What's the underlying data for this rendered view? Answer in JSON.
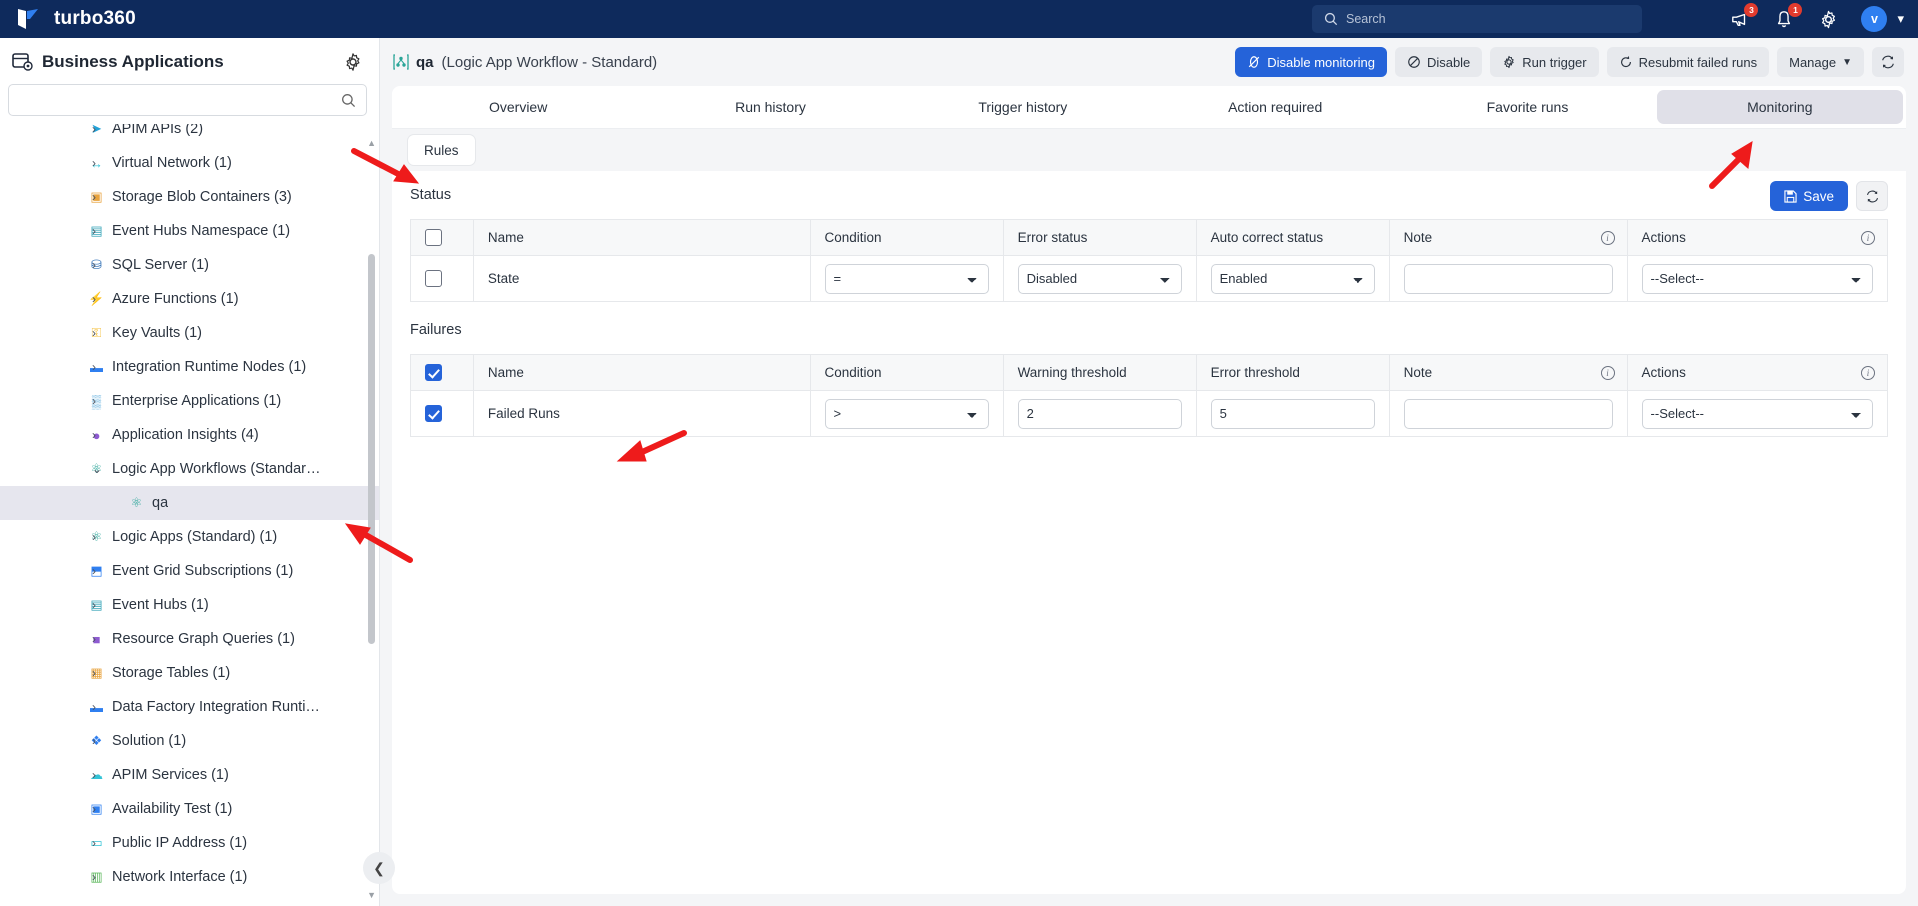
{
  "topbar": {
    "brand": "turbo360",
    "search_placeholder": "Search",
    "announce_badge": "3",
    "notification_badge": "1",
    "avatar_initial": "v",
    "icons": [
      "megaphone-icon",
      "bell-icon",
      "gear-icon",
      "avatar",
      "chevron-down-icon"
    ]
  },
  "sidebar": {
    "title": "Business Applications",
    "search_value": "",
    "search_placeholder": "",
    "tree": [
      {
        "label": "APIM APIs (2)",
        "level": 0,
        "expanded": false,
        "icon": "➤",
        "color": "#22a2d8",
        "selected": false
      },
      {
        "label": "Virtual Network (1)",
        "level": 0,
        "expanded": false,
        "icon": "↔",
        "color": "#33c3d6",
        "selected": false
      },
      {
        "label": "Storage Blob Containers (3)",
        "level": 0,
        "expanded": false,
        "icon": "▣",
        "color": "#e8a33d",
        "selected": false
      },
      {
        "label": "Event Hubs Namespace (1)",
        "level": 0,
        "expanded": false,
        "icon": "▤",
        "color": "#3aa6b9",
        "selected": false
      },
      {
        "label": "SQL Server (1)",
        "level": 0,
        "expanded": false,
        "icon": "⛁",
        "color": "#2f6fb5",
        "selected": false
      },
      {
        "label": "Azure Functions (1)",
        "level": 0,
        "expanded": false,
        "icon": "⚡",
        "color": "#f0b429",
        "selected": false
      },
      {
        "label": "Key Vaults (1)",
        "level": 0,
        "expanded": false,
        "icon": "⚿",
        "color": "#f4bf3a",
        "selected": false
      },
      {
        "label": "Integration Runtime Nodes (1)",
        "level": 0,
        "expanded": false,
        "icon": "▬",
        "color": "#2f7ff0",
        "selected": false
      },
      {
        "label": "Enterprise Applications (1)",
        "level": 0,
        "expanded": false,
        "icon": "▒",
        "color": "#3a9bd6",
        "selected": false
      },
      {
        "label": "Application Insights (4)",
        "level": 0,
        "expanded": false,
        "icon": "●",
        "color": "#8e5bd1",
        "selected": false
      },
      {
        "label": "Logic App Workflows (Standard…",
        "level": 0,
        "expanded": true,
        "icon": "⚛",
        "color": "#2aa598",
        "selected": false
      },
      {
        "label": "qa",
        "level": 2,
        "expanded": false,
        "icon": "⚛",
        "color": "#2aa598",
        "selected": true
      },
      {
        "label": "Logic Apps (Standard) (1)",
        "level": 0,
        "expanded": false,
        "icon": "⚛",
        "color": "#2aa598",
        "selected": false
      },
      {
        "label": "Event Grid Subscriptions (1)",
        "level": 0,
        "expanded": false,
        "icon": "⬒",
        "color": "#2f7ff0",
        "selected": false
      },
      {
        "label": "Event Hubs (1)",
        "level": 0,
        "expanded": false,
        "icon": "▤",
        "color": "#3aa6b9",
        "selected": false
      },
      {
        "label": "Resource Graph Queries (1)",
        "level": 0,
        "expanded": false,
        "icon": "■",
        "color": "#8e5bd1",
        "selected": false
      },
      {
        "label": "Storage Tables (1)",
        "level": 0,
        "expanded": false,
        "icon": "▦",
        "color": "#e8a33d",
        "selected": false
      },
      {
        "label": "Data Factory Integration Runti…",
        "level": 0,
        "expanded": false,
        "icon": "▬",
        "color": "#2f7ff0",
        "selected": false
      },
      {
        "label": "Solution (1)",
        "level": 0,
        "expanded": false,
        "icon": "❖",
        "color": "#2f7ff0",
        "selected": false
      },
      {
        "label": "APIM Services (1)",
        "level": 0,
        "expanded": false,
        "icon": "☁",
        "color": "#33c3d6",
        "selected": false
      },
      {
        "label": "Availability Test (1)",
        "level": 0,
        "expanded": false,
        "icon": "▣",
        "color": "#2f7ff0",
        "selected": false
      },
      {
        "label": "Public IP Address (1)",
        "level": 0,
        "expanded": false,
        "icon": "▭",
        "color": "#33c3d6",
        "selected": false
      },
      {
        "label": "Network Interface (1)",
        "level": 0,
        "expanded": false,
        "icon": "▥",
        "color": "#5cb85c",
        "selected": false
      }
    ],
    "collapse_icon": "chevron-left-icon"
  },
  "main": {
    "resource_name": "qa",
    "resource_type": "(Logic App Workflow - Standard)",
    "toolbar": [
      {
        "label": "Disable monitoring",
        "icon": "monitoring-off-icon",
        "primary": true
      },
      {
        "label": "Disable",
        "icon": "ban-icon",
        "primary": false
      },
      {
        "label": "Run trigger",
        "icon": "gear-icon",
        "primary": false
      },
      {
        "label": "Resubmit failed runs",
        "icon": "refresh-arrow-icon",
        "primary": false
      },
      {
        "label": "Manage",
        "icon": "chevron-down-icon",
        "primary": false
      }
    ],
    "refresh_icon": "refresh-icon",
    "tabs": [
      {
        "label": "Overview",
        "active": false
      },
      {
        "label": "Run history",
        "active": false
      },
      {
        "label": "Trigger history",
        "active": false
      },
      {
        "label": "Action required",
        "active": false
      },
      {
        "label": "Favorite runs",
        "active": false
      },
      {
        "label": "Monitoring",
        "active": true
      }
    ],
    "subtabs": [
      {
        "label": "Rules",
        "active": true
      }
    ],
    "save_label": "Save",
    "save_icon": "save-icon",
    "refresh_section_icon": "refresh-icon",
    "sections": [
      {
        "title": "Status",
        "header_checkbox": false,
        "columns": [
          {
            "label": "",
            "type": "checkbox"
          },
          {
            "label": "Name",
            "type": "text"
          },
          {
            "label": "Condition",
            "type": "select"
          },
          {
            "label": "Error status",
            "type": "select"
          },
          {
            "label": "Auto correct status",
            "type": "select"
          },
          {
            "label": "Note",
            "type": "input",
            "info": true
          },
          {
            "label": "Actions",
            "type": "select",
            "info": true
          }
        ],
        "rows": [
          {
            "checked": false,
            "name": "State",
            "condition": "=",
            "error_status": "Disabled",
            "auto_correct_status": "Enabled",
            "note": "",
            "actions": "--Select--"
          }
        ]
      },
      {
        "title": "Failures",
        "header_checkbox": true,
        "columns": [
          {
            "label": "",
            "type": "checkbox"
          },
          {
            "label": "Name",
            "type": "text"
          },
          {
            "label": "Condition",
            "type": "select"
          },
          {
            "label": "Warning threshold",
            "type": "input"
          },
          {
            "label": "Error threshold",
            "type": "input"
          },
          {
            "label": "Note",
            "type": "input",
            "info": true
          },
          {
            "label": "Actions",
            "type": "select",
            "info": true
          }
        ],
        "rows": [
          {
            "checked": true,
            "name": "Failed Runs",
            "condition": ">",
            "warning_threshold": "2",
            "error_threshold": "5",
            "note": "",
            "actions": "--Select--"
          }
        ]
      }
    ]
  },
  "annotations": {
    "arrow_color": "#ee1b1b",
    "count": 4
  }
}
